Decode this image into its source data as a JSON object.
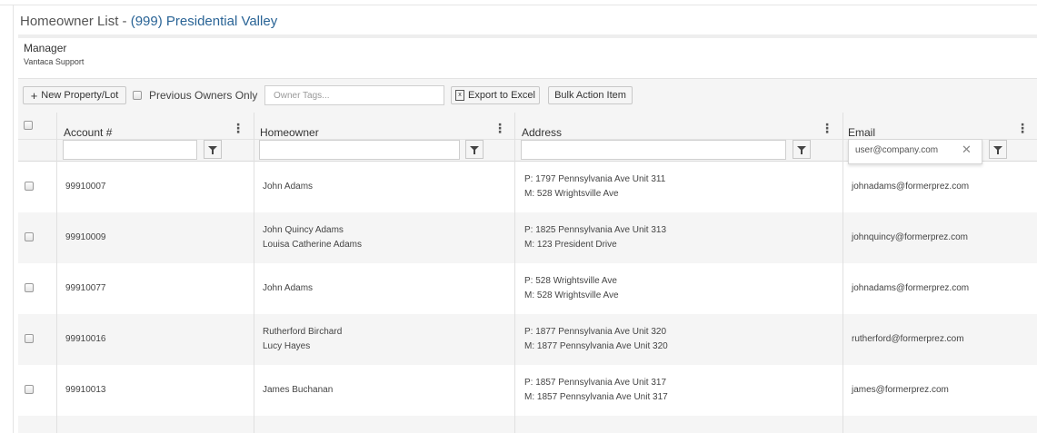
{
  "page": {
    "title_prefix": "Homeowner List - ",
    "title_link": "(999) Presidential Valley"
  },
  "manager": {
    "label": "Manager",
    "value": "Vantaca Support"
  },
  "toolbar": {
    "new_property_label": "New Property/Lot",
    "previous_owners_label": "Previous Owners Only",
    "owner_tags_placeholder": "Owner Tags...",
    "export_label": "Export to Excel",
    "bulk_action_label": "Bulk Action Item"
  },
  "columns": {
    "account": "Account #",
    "homeowner": "Homeowner",
    "address": "Address",
    "email": "Email"
  },
  "filters": {
    "email_value": "user@company.com"
  },
  "rows": [
    {
      "account": "99910007",
      "owner1": "John Adams",
      "owner2": "",
      "addr_p": "P: 1797 Pennsylvania Ave Unit 311",
      "addr_m": "M: 528 Wrightsville Ave",
      "email": "johnadams@formerprez.com"
    },
    {
      "account": "99910009",
      "owner1": "John Quincy Adams",
      "owner2": "Louisa Catherine Adams",
      "addr_p": "P: 1825 Pennsylvania Ave Unit 313",
      "addr_m": "M: 123 President Drive",
      "email": "johnquincy@formerprez.com"
    },
    {
      "account": "99910077",
      "owner1": "John Adams",
      "owner2": "",
      "addr_p": "P: 528 Wrightsville Ave",
      "addr_m": "M: 528 Wrightsville Ave",
      "email": "johnadams@formerprez.com"
    },
    {
      "account": "99910016",
      "owner1": "Rutherford Birchard",
      "owner2": "Lucy Hayes",
      "addr_p": "P: 1877 Pennsylvania Ave Unit 320",
      "addr_m": "M: 1877 Pennsylvania Ave Unit 320",
      "email": "rutherford@formerprez.com"
    },
    {
      "account": "99910013",
      "owner1": "James Buchanan",
      "owner2": "",
      "addr_p": "P: 1857 Pennsylvania Ave Unit 317",
      "addr_m": "M: 1857 Pennsylvania Ave Unit 317",
      "email": "james@formerprez.com"
    }
  ]
}
